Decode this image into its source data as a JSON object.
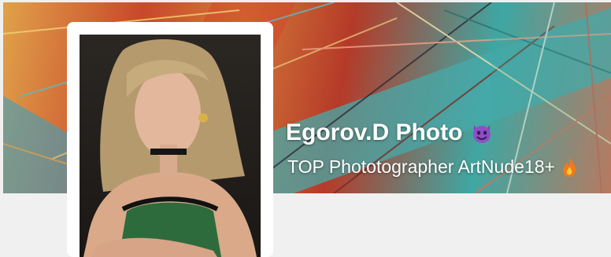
{
  "profile": {
    "name": "Egorov.D Photo",
    "name_emoji": "devil-face-icon",
    "tagline": "TOP Phototographer ArtNude18+",
    "tagline_emoji": "fire-icon"
  },
  "colors": {
    "background": "#f0f0f0",
    "frame": "#ffffff",
    "text": "#ffffff"
  }
}
